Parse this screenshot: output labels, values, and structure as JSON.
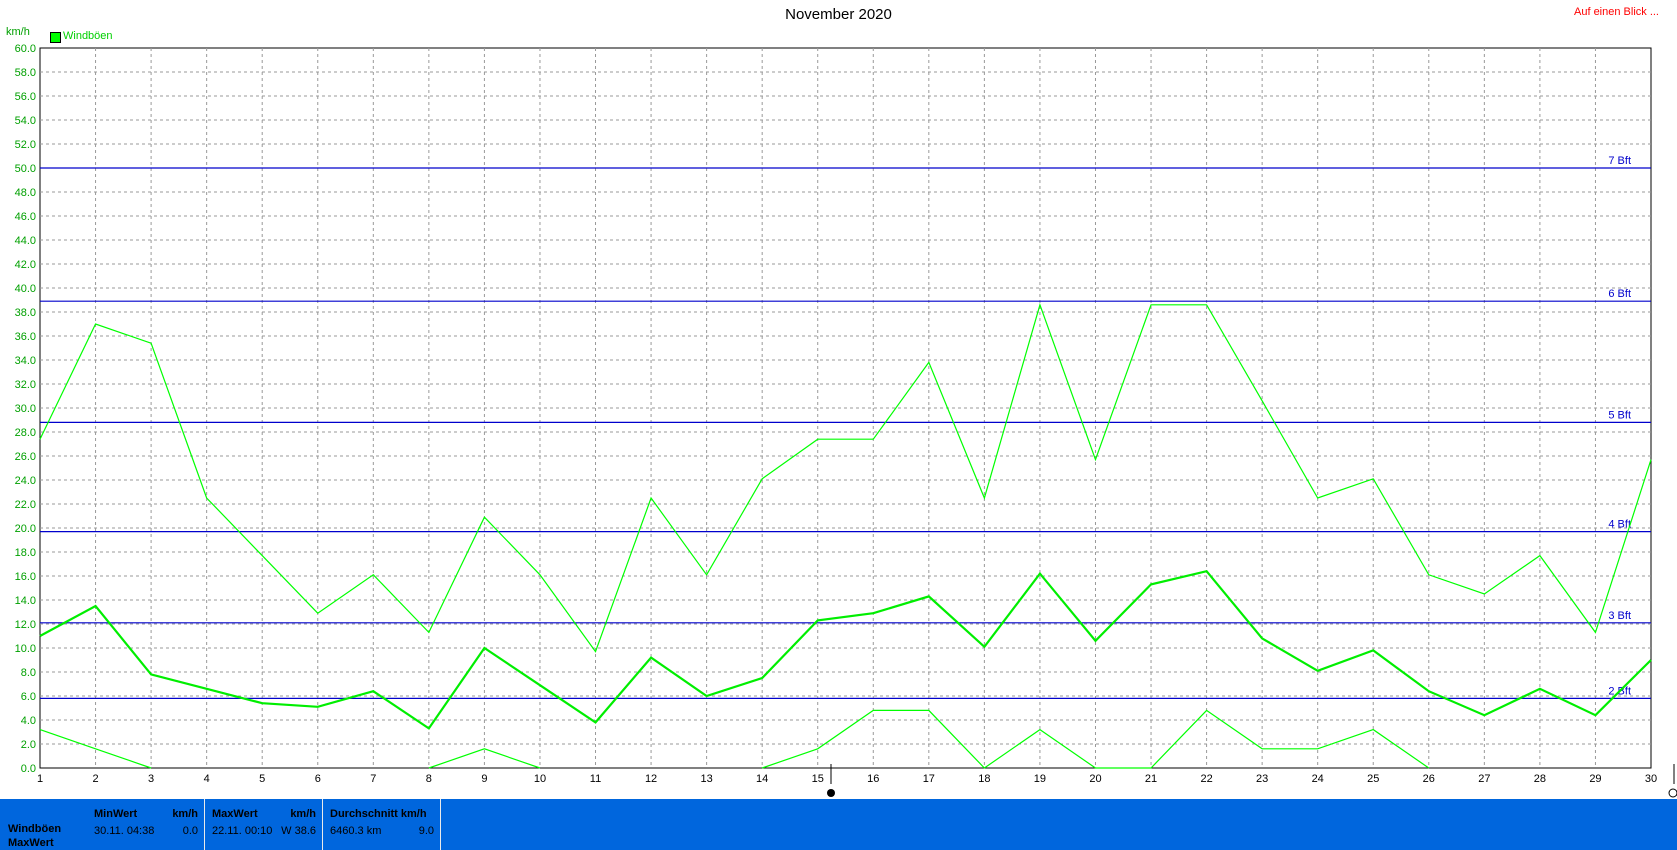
{
  "title": "November 2020",
  "top_link": "Auf einen Blick ...",
  "unit_label": "km/h",
  "legend": {
    "label": "Windböen",
    "color": "#00ff00"
  },
  "chart_data": {
    "type": "line",
    "title": "November 2020",
    "ylabel": "km/h",
    "xlabel": "",
    "ylim": [
      0,
      60
    ],
    "ytick_step": 2,
    "grid": true,
    "legend_position": "top-left",
    "x": [
      1,
      2,
      3,
      4,
      5,
      6,
      7,
      8,
      9,
      10,
      11,
      12,
      13,
      14,
      15,
      16,
      17,
      18,
      19,
      20,
      21,
      22,
      23,
      24,
      25,
      26,
      27,
      28,
      29,
      30
    ],
    "series": [
      {
        "name": "Windböen",
        "role": "max",
        "color": "#00ff00",
        "values": [
          27.4,
          37.0,
          35.4,
          22.5,
          17.7,
          12.9,
          16.1,
          11.3,
          20.9,
          16.1,
          9.7,
          22.5,
          16.1,
          24.1,
          27.4,
          27.4,
          33.8,
          22.5,
          38.6,
          25.7,
          38.6,
          38.6,
          30.6,
          22.5,
          24.1,
          16.1,
          14.5,
          17.7,
          11.3,
          25.7
        ]
      },
      {
        "name": "Windböen",
        "role": "avg",
        "color": "#00ee00",
        "values": [
          11.0,
          13.5,
          7.8,
          6.6,
          5.4,
          5.1,
          6.4,
          3.3,
          10.0,
          6.9,
          3.8,
          9.2,
          6.0,
          7.5,
          12.3,
          12.9,
          14.3,
          10.1,
          16.2,
          10.6,
          15.3,
          16.4,
          10.8,
          8.1,
          9.8,
          6.4,
          4.4,
          6.6,
          4.4,
          9.0
        ]
      },
      {
        "name": "Windböen",
        "role": "min",
        "color": "#00ff00",
        "values": [
          3.2,
          1.6,
          0.0,
          null,
          null,
          null,
          null,
          0.0,
          1.6,
          0.0,
          null,
          null,
          null,
          0.0,
          1.6,
          4.8,
          4.8,
          0.0,
          3.2,
          0.0,
          0.0,
          4.8,
          1.6,
          1.6,
          3.2,
          0.0,
          null,
          null,
          null,
          null
        ]
      }
    ],
    "reference_lines": [
      {
        "label": "7 Bft",
        "value": 50.0
      },
      {
        "label": "6 Bft",
        "value": 38.9
      },
      {
        "label": "5 Bft",
        "value": 28.8
      },
      {
        "label": "4 Bft",
        "value": 19.7
      },
      {
        "label": "3 Bft",
        "value": 12.1
      },
      {
        "label": "2 Bft",
        "value": 5.8
      }
    ]
  },
  "footer": {
    "row_label_1": "Windböen",
    "row_label_2": "MaxWert",
    "min": {
      "header": "MinWert",
      "unit": "km/h",
      "time": "30.11.  04:38",
      "value": "0.0"
    },
    "max": {
      "header": "MaxWert",
      "unit": "km/h",
      "time": "22.11.  00:10",
      "value": "W 38.6"
    },
    "avg": {
      "header": "Durchschnitt km/h",
      "distance": "6460.3 km",
      "value": "9.0"
    }
  }
}
